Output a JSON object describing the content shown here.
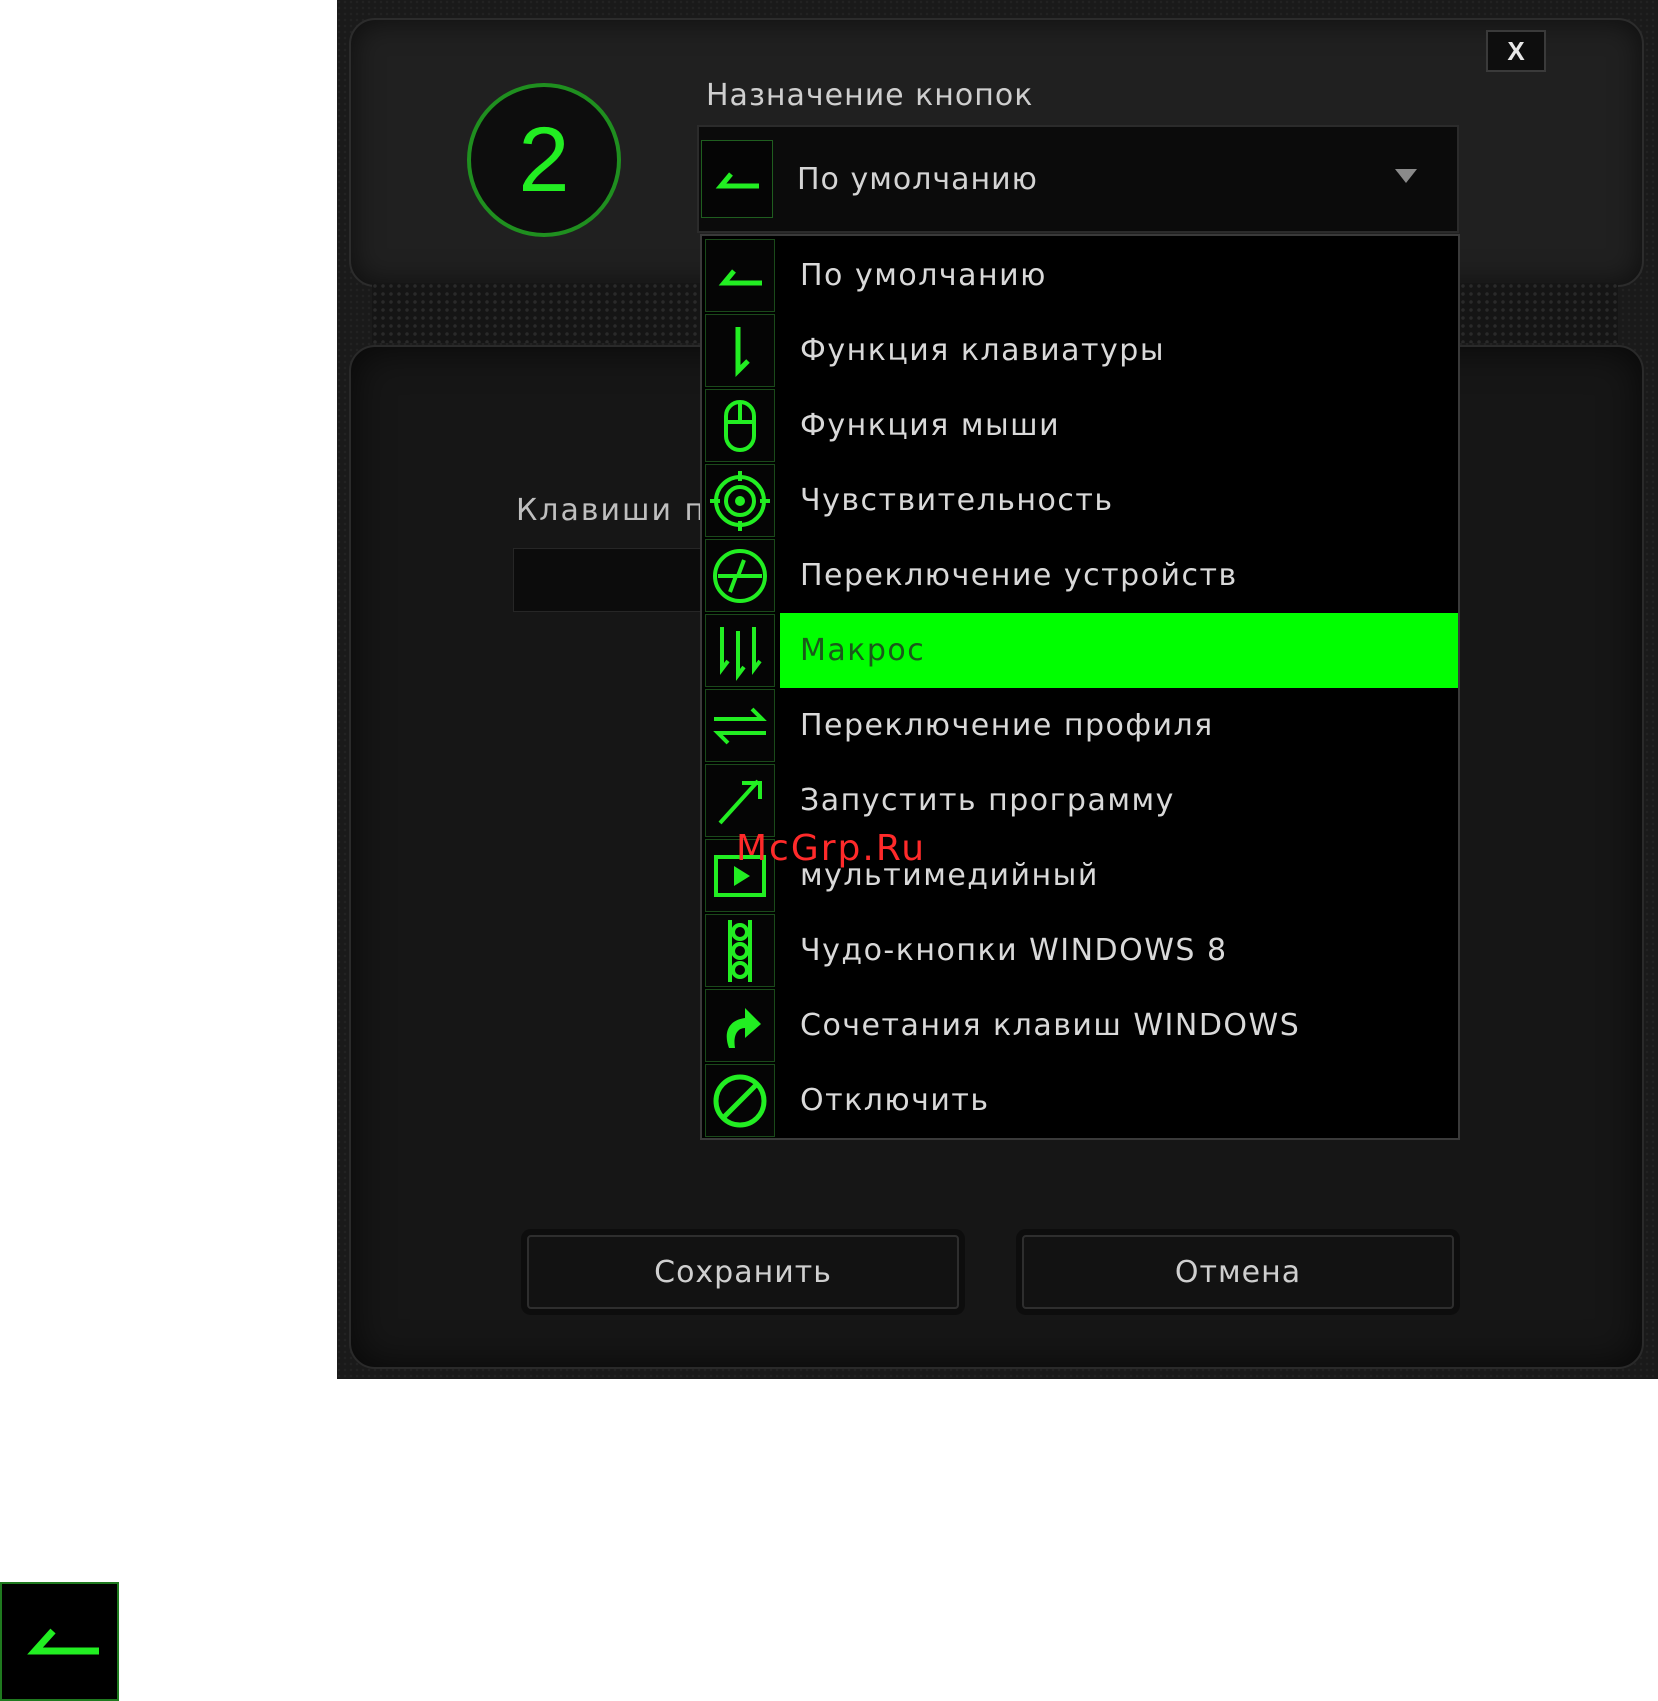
{
  "dialog": {
    "close_label": "X",
    "button_number": "2",
    "section_title": "Назначение кнопок",
    "select": {
      "value": "По умолчанию",
      "icon": "default-return-arrow-icon"
    },
    "underlying_label": "Клавиши п"
  },
  "dropdown": {
    "items": [
      {
        "label": "По умолчанию",
        "icon": "default-return-arrow-icon"
      },
      {
        "label": "Функция клавиатуры",
        "icon": "keyboard-down-arrow-icon"
      },
      {
        "label": "Функция мыши",
        "icon": "mouse-icon"
      },
      {
        "label": "Чувствительность",
        "icon": "target-icon"
      },
      {
        "label": "Переключение устройств",
        "icon": "device-switch-icon"
      },
      {
        "label": "Макрос",
        "icon": "macro-arrows-icon",
        "selected": true
      },
      {
        "label": "Переключение профиля",
        "icon": "profile-switch-icon"
      },
      {
        "label": "Запустить программу",
        "icon": "launch-program-icon"
      },
      {
        "label": "мультимедийный",
        "icon": "multimedia-play-icon"
      },
      {
        "label": "Чудо-кнопки WINDOWS 8",
        "icon": "charms-icon"
      },
      {
        "label": "Сочетания клавиш WINDOWS",
        "icon": "shortcut-arrow-icon"
      },
      {
        "label": "Отключить",
        "icon": "disable-icon"
      }
    ],
    "selected_index": 5
  },
  "buttons": {
    "save": "Сохранить",
    "cancel": "Отмена"
  },
  "watermark": "McGrp.Ru",
  "colors": {
    "accent": "#00ff00",
    "icon_green": "#22ee22",
    "background": "#1a1a1a",
    "watermark": "#ff2a2a"
  }
}
